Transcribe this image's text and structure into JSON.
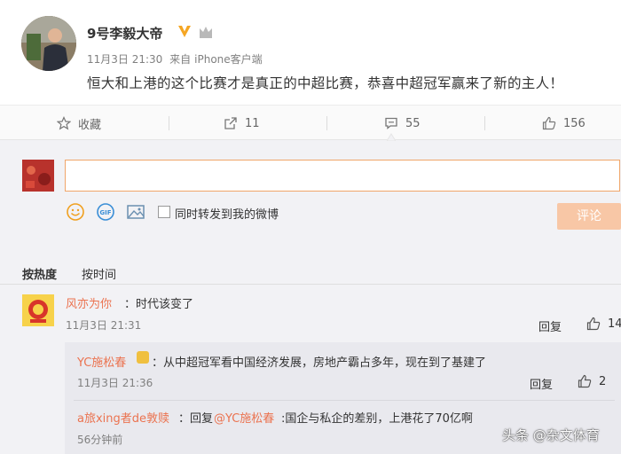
{
  "post": {
    "username": "9号李毅大帝",
    "date": "11月3日 21:30",
    "source_prefix": "来自",
    "source": "iPhone客户端",
    "text": "恒大和上港的这个比赛才是真正的中超比赛，恭喜中超冠军赢来了新的主人！"
  },
  "actions": {
    "favorite_label": "收藏",
    "repost_count": "11",
    "comment_count": "55",
    "like_count": "156"
  },
  "composer": {
    "placeholder": "",
    "repost_checkbox_label": "同时转发到我的微博",
    "submit_label": "评论"
  },
  "sort": {
    "by_hot": "按热度",
    "by_time": "按时间"
  },
  "comments": [
    {
      "user": "风亦为你",
      "text": "：时代该变了",
      "time": "11月3日 21:31",
      "reply_label": "回复",
      "likes": "14"
    }
  ],
  "replies": [
    {
      "user": "YC施松春",
      "text": "：从中超冠军看中国经济发展，房地产霸占多年，现在到了基建了",
      "time": "11月3日 21:36",
      "reply_label": "回复",
      "likes": "2"
    },
    {
      "user": "a旅xing者de敦赎",
      "text_prefix": "：回复",
      "mention": "@YC施松春",
      "text": ":国企与私企的差别，上港花了70亿啊",
      "time": "56分钟前"
    }
  ],
  "watermark": "头条 @杂文体育",
  "colors": {
    "accent": "#eb7350",
    "submit_disabled": "#f8c7a6",
    "panel_bg": "#f2f2f5"
  }
}
